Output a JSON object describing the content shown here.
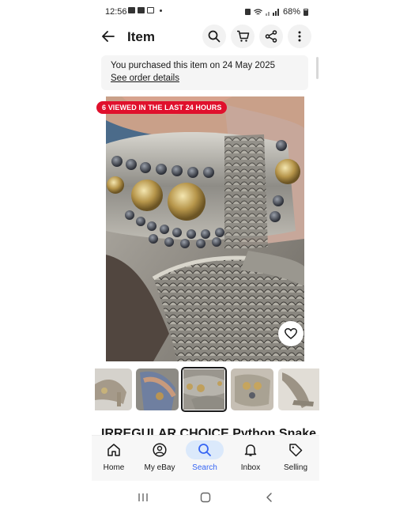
{
  "status_bar": {
    "time": "12:56",
    "battery": "68%"
  },
  "header": {
    "title": "Item",
    "icons": [
      "back-arrow-icon",
      "search-icon",
      "cart-icon",
      "share-icon",
      "more-vert-icon"
    ]
  },
  "purchase_notice": {
    "text": "You purchased this item on 24 May 2025",
    "link": "See order details"
  },
  "gallery": {
    "badge": "6 VIEWED IN THE LAST 24 HOURS",
    "thumbnails_count": 5,
    "selected_index": 2
  },
  "product": {
    "title": "IRREGULAR CHOICE Python Snake"
  },
  "bottom_nav": {
    "items": [
      {
        "label": "Home",
        "icon": "home-icon"
      },
      {
        "label": "My eBay",
        "icon": "user-icon"
      },
      {
        "label": "Search",
        "icon": "search-icon"
      },
      {
        "label": "Inbox",
        "icon": "bell-icon"
      },
      {
        "label": "Selling",
        "icon": "tag-icon"
      }
    ],
    "active": "Search"
  },
  "colors": {
    "badge_red": "#e0102c",
    "accent_blue": "#3665f3",
    "active_pill": "#dbe9fb"
  }
}
